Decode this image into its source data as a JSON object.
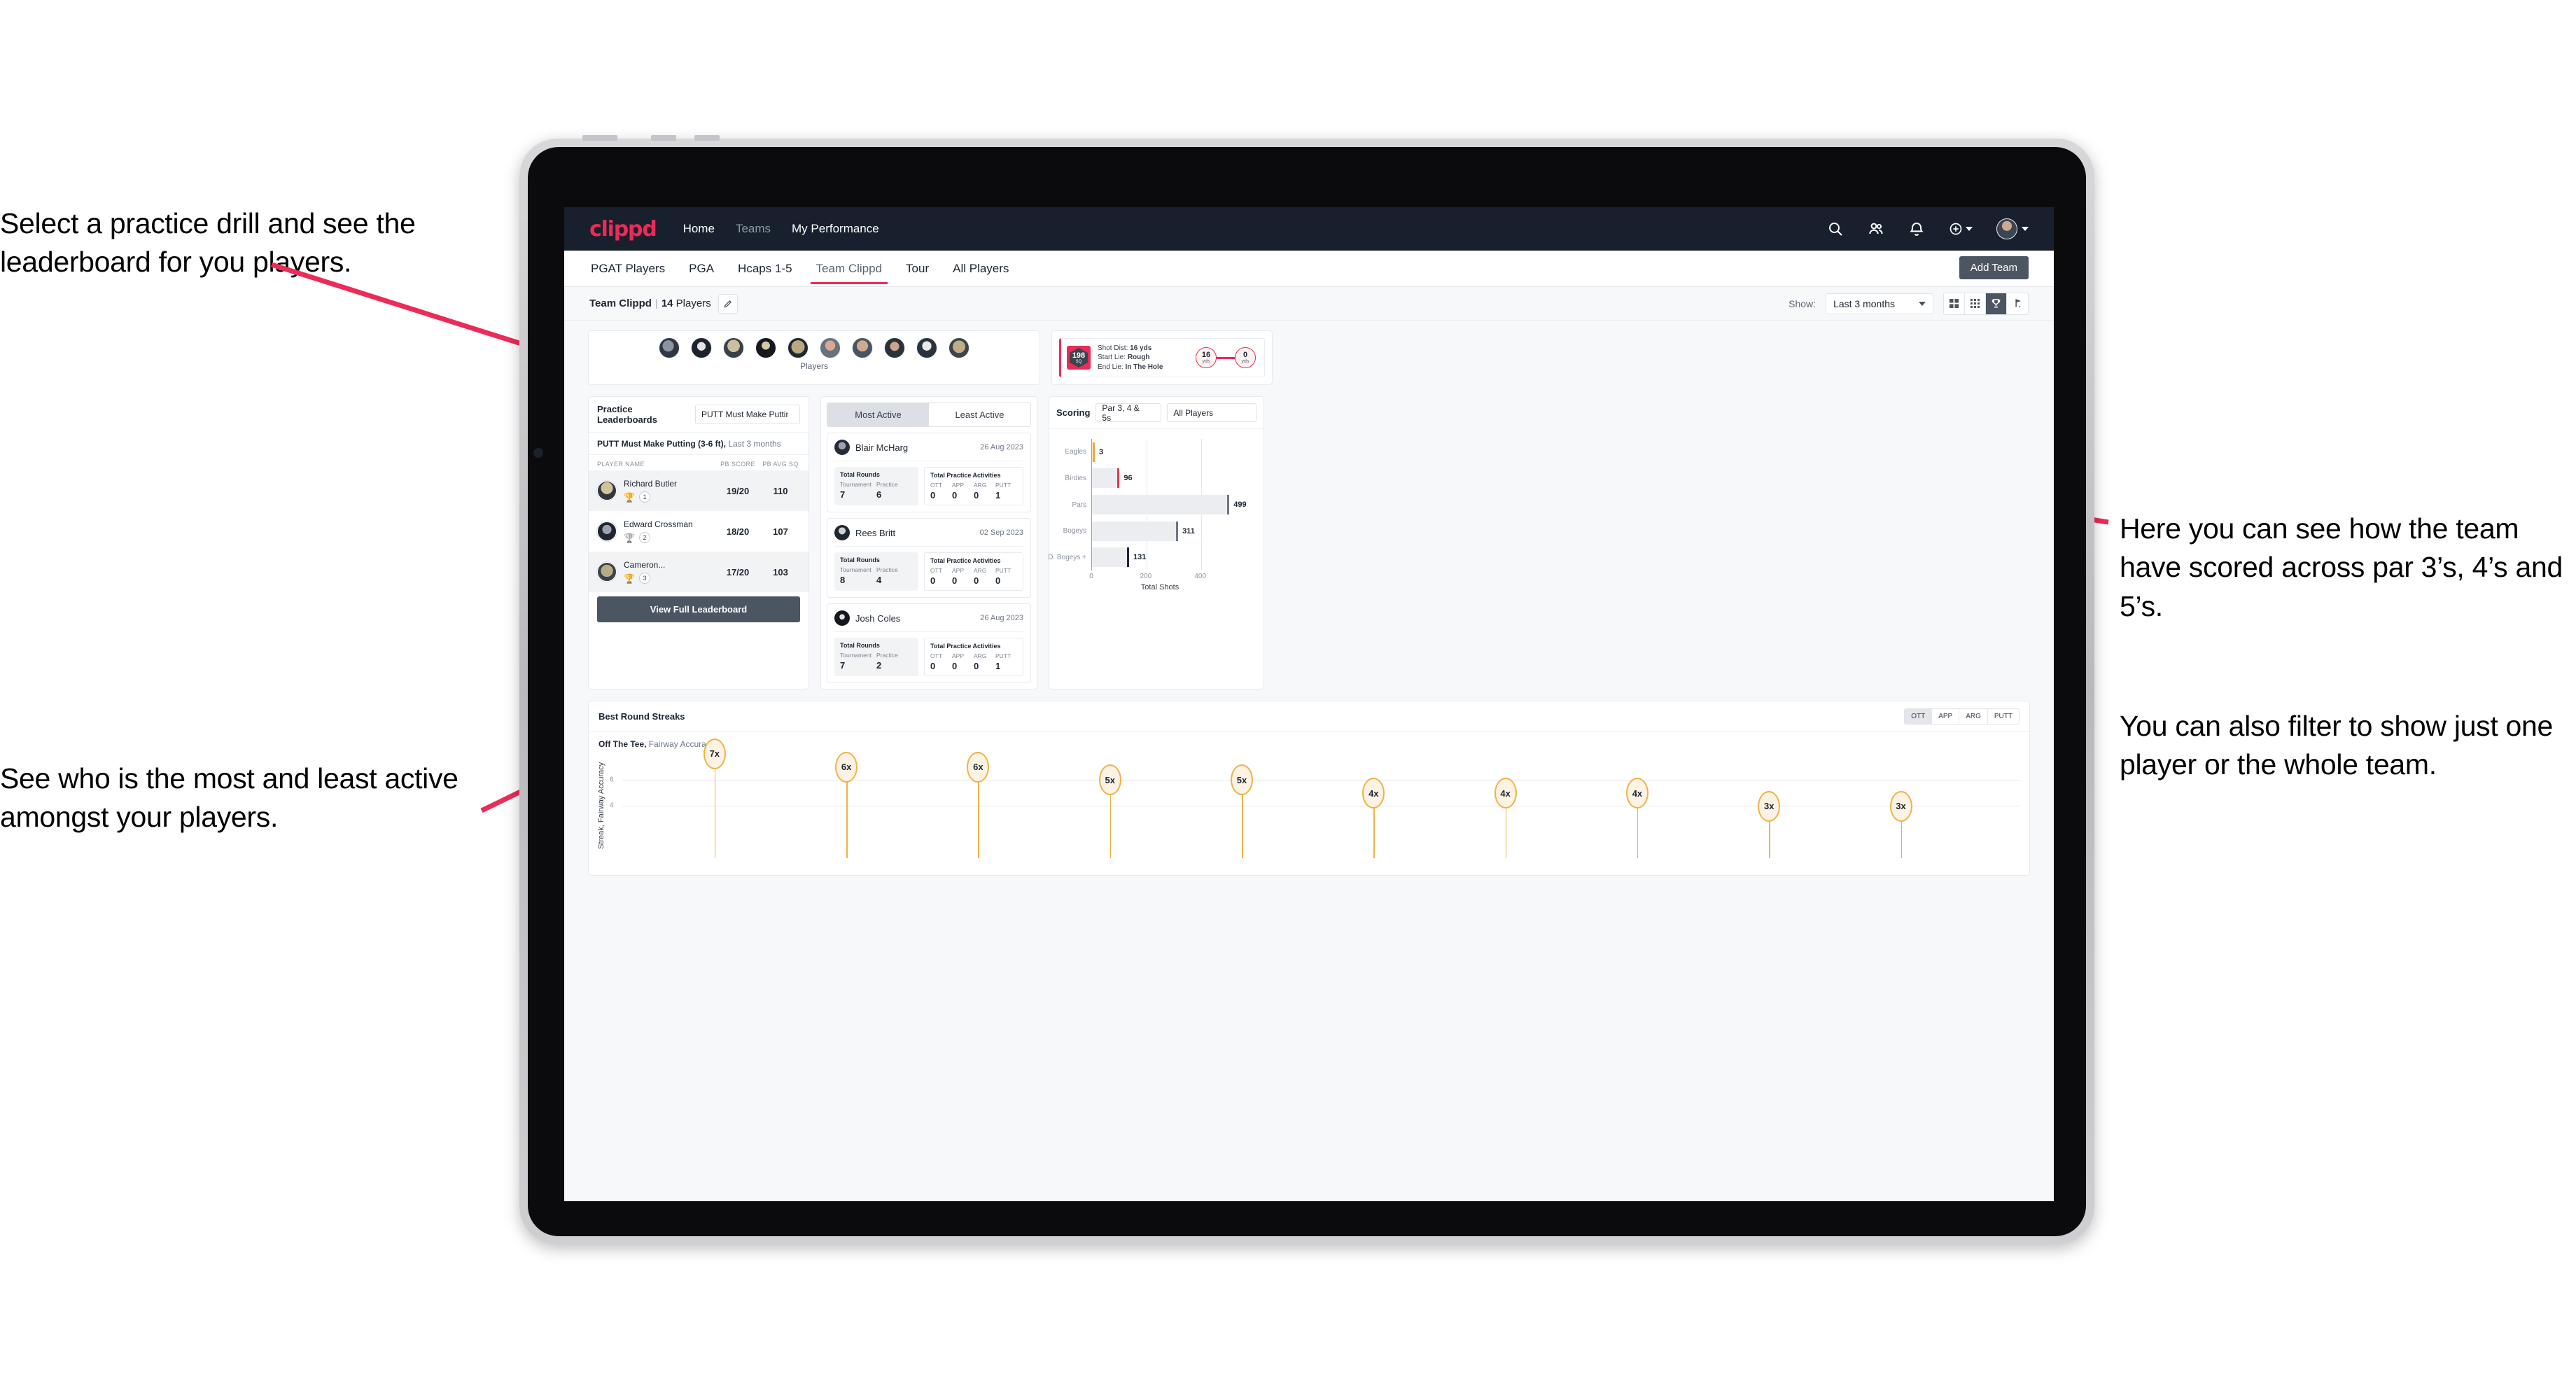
{
  "annotations": {
    "left_top": "Select a practice drill and see the leaderboard for you players.",
    "left_bottom": "See who is the most and least active amongst your players.",
    "right_top": "Here you can see how the team have scored across par 3’s, 4’s and 5’s.",
    "right_bottom": "You can also filter to show just one player or the whole team."
  },
  "navbar": {
    "logo": "clippd",
    "links": [
      {
        "label": "Home",
        "active": true
      },
      {
        "label": "Teams",
        "active": false
      },
      {
        "label": "My Performance",
        "active": true
      }
    ],
    "icons": [
      "search-icon",
      "people-icon",
      "bell-icon",
      "plus-circle-icon",
      "avatar"
    ]
  },
  "tabs": {
    "items": [
      {
        "label": "PGAT Players",
        "active": false
      },
      {
        "label": "PGA",
        "active": false
      },
      {
        "label": "Hcaps 1-5",
        "active": false
      },
      {
        "label": "Team Clippd",
        "active": true
      },
      {
        "label": "Tour",
        "active": false
      },
      {
        "label": "All Players",
        "active": false
      }
    ],
    "add_team_label": "Add Team"
  },
  "subbar": {
    "team_name": "Team Clippd",
    "separator": "|",
    "player_count": "14",
    "players_word": "Players",
    "edit_icon": "pencil-icon",
    "show_label": "Show:",
    "range_value": "Last 3 months",
    "view_toggles": [
      {
        "icon": "grid-4-icon",
        "active": false
      },
      {
        "icon": "grid-9-icon",
        "active": false
      },
      {
        "icon": "trophy-icon",
        "active": true
      },
      {
        "icon": "golf-flag-icon",
        "active": false
      }
    ]
  },
  "players_strip": {
    "label": "Players",
    "count": 10
  },
  "shot_card": {
    "sq_value": "198",
    "sq_unit": "SQ",
    "lines": [
      {
        "label": "Shot Dist:",
        "value": "16 yds"
      },
      {
        "label": "Start Lie:",
        "value": "Rough"
      },
      {
        "label": "End Lie:",
        "value": "In The Hole"
      }
    ],
    "start_node": {
      "value": "16",
      "unit": "yds"
    },
    "end_node": {
      "value": "0",
      "unit": "yds"
    }
  },
  "leaderboard": {
    "title": "Practice Leaderboards",
    "drill_select": "PUTT Must Make Putting ...",
    "subtitle_bold": "PUTT Must Make Putting (3-6 ft),",
    "subtitle_muted": "Last 3 months",
    "columns": [
      "PLAYER NAME",
      "PB SCORE",
      "PB AVG SQ"
    ],
    "rows": [
      {
        "name": "Richard Butler",
        "score": "19/20",
        "sq": "110",
        "rank": "1",
        "trophy": "gold"
      },
      {
        "name": "Edward Crossman",
        "score": "18/20",
        "sq": "107",
        "rank": "2",
        "trophy": "silver"
      },
      {
        "name": "Cameron...",
        "score": "17/20",
        "sq": "103",
        "rank": "3",
        "trophy": "bronze"
      }
    ],
    "button_label": "View Full Leaderboard"
  },
  "activity": {
    "tabs": [
      {
        "label": "Most Active",
        "active": true
      },
      {
        "label": "Least Active",
        "active": false
      }
    ],
    "rounds_title": "Total Rounds",
    "rounds_keys": [
      "Tournament",
      "Practice"
    ],
    "acts_title": "Total Practice Activities",
    "acts_keys": [
      "OTT",
      "APP",
      "ARG",
      "PUTT"
    ],
    "cards": [
      {
        "name": "Blair McHarg",
        "date": "26 Aug 2023",
        "rounds": [
          "7",
          "6"
        ],
        "acts": [
          "0",
          "0",
          "0",
          "1"
        ]
      },
      {
        "name": "Rees Britt",
        "date": "02 Sep 2023",
        "rounds": [
          "8",
          "4"
        ],
        "acts": [
          "0",
          "0",
          "0",
          "0"
        ]
      },
      {
        "name": "Josh Coles",
        "date": "26 Aug 2023",
        "rounds": [
          "7",
          "2"
        ],
        "acts": [
          "0",
          "0",
          "0",
          "1"
        ]
      }
    ]
  },
  "scoring": {
    "title": "Scoring",
    "par_select": "Par 3, 4 & 5s",
    "player_select": "All Players"
  },
  "streaks": {
    "title": "Best Round Streaks",
    "toggles": [
      {
        "label": "OTT",
        "active": true
      },
      {
        "label": "APP",
        "active": false
      },
      {
        "label": "ARG",
        "active": false
      },
      {
        "label": "PUTT",
        "active": false
      }
    ],
    "sub_bold": "Off The Tee,",
    "sub_muted": "Fairway Accuracy"
  },
  "colors": {
    "brand_pink": "#ec2b58",
    "nav_dark": "#17202c",
    "button_slate": "#4c5562",
    "bar_gray": "#ebedf0",
    "amber": "#f0b244"
  },
  "chart_data": [
    {
      "type": "bar",
      "orientation": "horizontal",
      "title": "Scoring",
      "categories": [
        "Eagles",
        "Birdies",
        "Pars",
        "Bogeys",
        "D. Bogeys +"
      ],
      "values": [
        3,
        96,
        499,
        311,
        131
      ],
      "cap_colors": [
        "#f0a92e",
        "#e8334a",
        "#6e7680",
        "#6e7680",
        "#1d2530"
      ],
      "xlabel": "Total Shots",
      "ylabel": "",
      "xlim": [
        0,
        560
      ],
      "xticks": [
        0,
        200,
        400
      ],
      "grid": true,
      "legend": "none"
    },
    {
      "type": "scatter",
      "title": "Best Round Streaks",
      "subtitle": "Off The Tee, Fairway Accuracy",
      "ylabel": "Streak, Fairway Accuracy",
      "xlabel": "",
      "yticks": [
        4,
        6
      ],
      "ylim": [
        0,
        8
      ],
      "labels": [
        "7x",
        "6x",
        "6x",
        "5x",
        "5x",
        "4x",
        "4x",
        "4x",
        "3x",
        "3x"
      ],
      "values": [
        7,
        6,
        6,
        5,
        5,
        4,
        4,
        4,
        3,
        3
      ],
      "grid": true,
      "legend": "none"
    }
  ]
}
